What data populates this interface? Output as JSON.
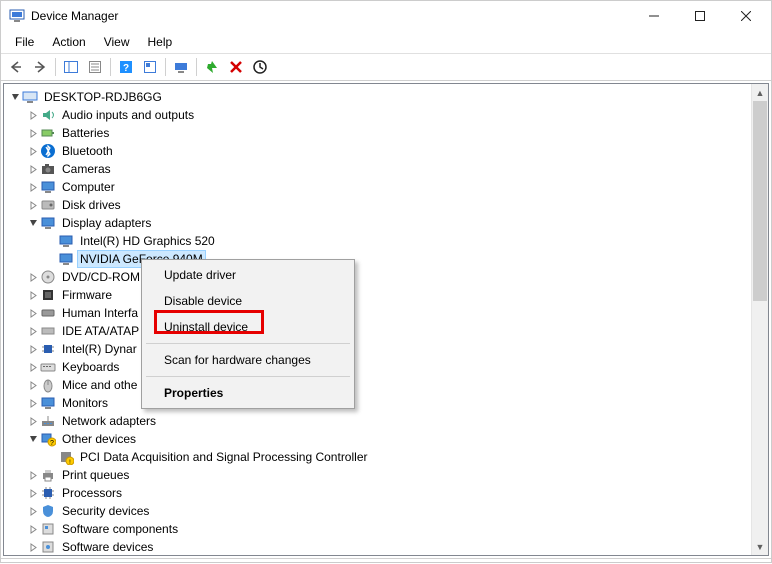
{
  "window": {
    "title": "Device Manager"
  },
  "menu": {
    "file": "File",
    "action": "Action",
    "view": "View",
    "help": "Help"
  },
  "tree": {
    "root": "DESKTOP-RDJB6GG",
    "audio": "Audio inputs and outputs",
    "batteries": "Batteries",
    "bluetooth": "Bluetooth",
    "cameras": "Cameras",
    "computer": "Computer",
    "disk": "Disk drives",
    "display": "Display adapters",
    "intel_gfx": "Intel(R) HD Graphics 520",
    "nvidia": "NVIDIA GeForce 940M",
    "dvd": "DVD/CD-ROM",
    "firmware": "Firmware",
    "hid": "Human Interfa",
    "ide": "IDE ATA/ATAP",
    "dynamic": "Intel(R) Dynar",
    "keyboards": "Keyboards",
    "mice": "Mice and othe",
    "monitors": "Monitors",
    "network": "Network adapters",
    "other": "Other devices",
    "pci": "PCI Data Acquisition and Signal Processing Controller",
    "printq": "Print queues",
    "processors": "Processors",
    "security": "Security devices",
    "swcomp": "Software components",
    "swdev": "Software devices"
  },
  "context_menu": {
    "update": "Update driver",
    "disable": "Disable device",
    "uninstall": "Uninstall device",
    "scan": "Scan for hardware changes",
    "properties": "Properties"
  }
}
